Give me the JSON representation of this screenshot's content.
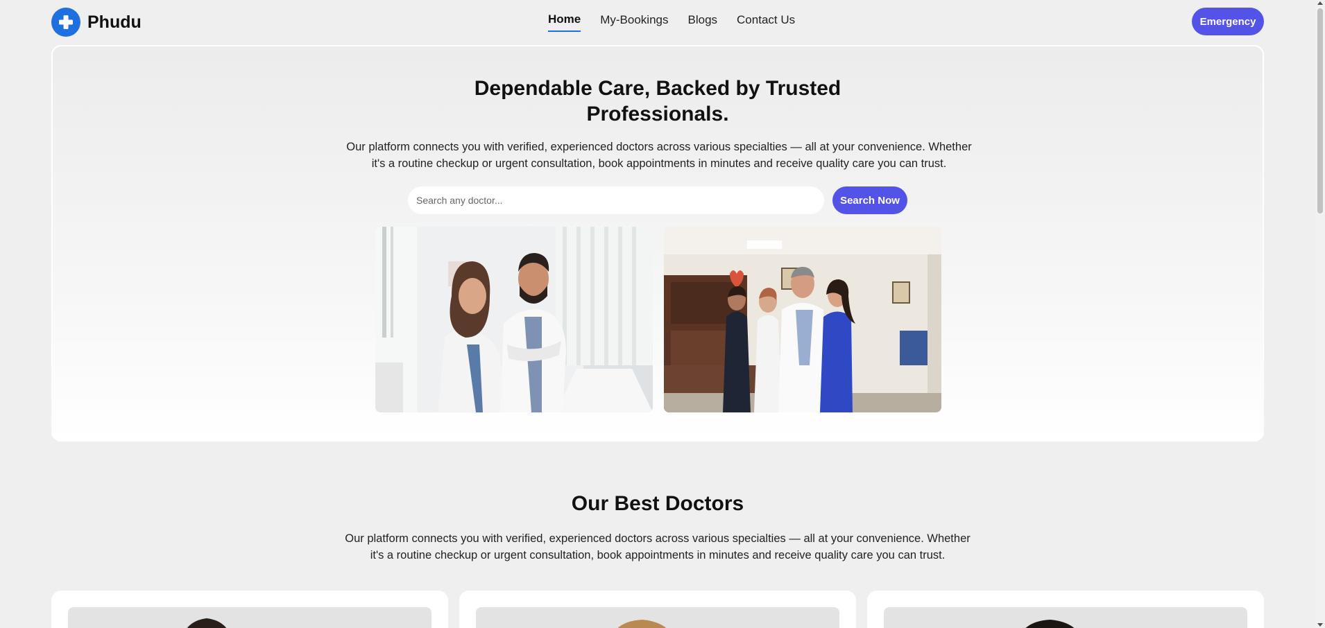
{
  "header": {
    "brand_name": "Phudu",
    "logo_icon": "plus-icon",
    "nav": [
      {
        "label": "Home",
        "active": true
      },
      {
        "label": "My-Bookings",
        "active": false
      },
      {
        "label": "Blogs",
        "active": false
      },
      {
        "label": "Contact Us",
        "active": false
      }
    ],
    "emergency_label": "Emergency"
  },
  "hero": {
    "title_line1": "Dependable Care, Backed by Trusted",
    "title_line2": "Professionals.",
    "description": "Our platform connects you with verified, experienced doctors across various specialties — all at your convenience. Whether it's a routine checkup or urgent consultation, book appointments in minutes and receive quality care you can trust.",
    "search_placeholder": "Search any doctor...",
    "search_button": "Search Now"
  },
  "doctors_section": {
    "title": "Our Best Doctors",
    "description": "Our platform connects you with verified, experienced doctors across various specialties — all at your convenience. Whether it's a routine checkup or urgent consultation, book appointments in minutes and receive quality care you can trust."
  },
  "colors": {
    "accent": "#5353e8",
    "brand_blue": "#1e6fe0",
    "background": "#efefef"
  }
}
